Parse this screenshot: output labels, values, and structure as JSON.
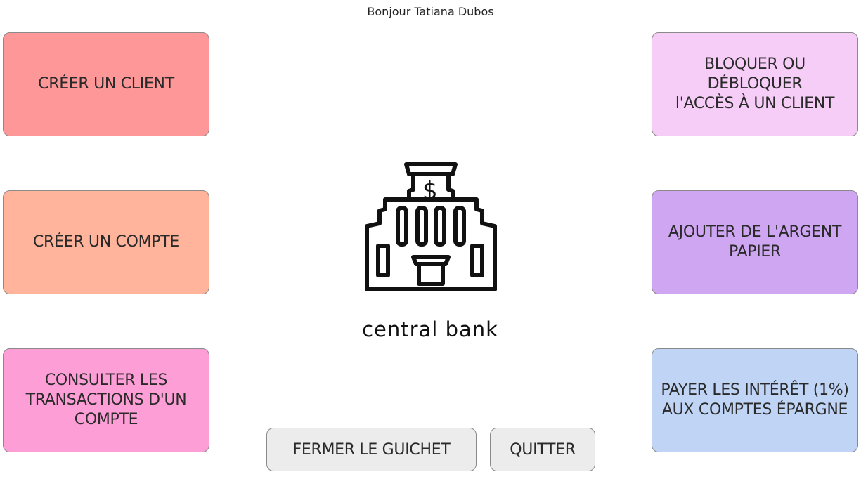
{
  "greeting": "Bonjour Tatiana Dubos",
  "bank": {
    "name": "central bank",
    "icon": "bank-building-icon"
  },
  "left_tiles": [
    {
      "lines": [
        "CRÉER UN CLIENT"
      ],
      "color": "#fe9797"
    },
    {
      "lines": [
        "CRÉER UN COMPTE"
      ],
      "color": "#ffb49b"
    },
    {
      "lines": [
        "CONSULTER LES",
        "TRANSACTIONS D'UN",
        "COMPTE"
      ],
      "color": "#fd9fd6"
    }
  ],
  "right_tiles": [
    {
      "lines": [
        "BLOQUER OU DÉBLOQUER",
        "l'ACCÈS À UN CLIENT"
      ],
      "color": "#f6cdf6"
    },
    {
      "lines": [
        "AJOUTER DE L'ARGENT",
        "PAPIER"
      ],
      "color": "#cfa6f2"
    },
    {
      "lines": [
        "PAYER LES INTÉRÊT (1%)",
        "AUX COMPTES ÉPARGNE"
      ],
      "color": "#c0d4f6"
    }
  ],
  "buttons": {
    "close_counter": "FERMER LE GUICHET",
    "quit": "QUITTER"
  }
}
